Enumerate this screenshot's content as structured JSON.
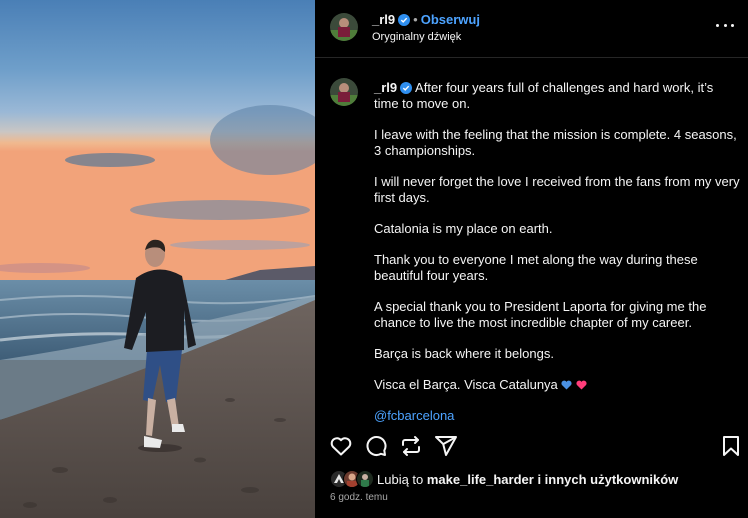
{
  "post": {
    "username": "_rl9",
    "separator": "•",
    "follow_label": "Obserwuj",
    "audio_label": "Oryginalny dźwięk"
  },
  "caption": {
    "username": "_rl9",
    "first_line": "After four years full of challenges and hard work, it’s time to move on.",
    "paragraphs": [
      "I leave with the feeling that the mission is complete. 4 seasons, 3 championships.",
      "I will never forget the love I received from the fans from my very first days.",
      "Catalonia is my place on earth.",
      "Thank you to everyone I met along the way during these beautiful four years.",
      "A special thank you to President Laporta for giving me the chance to live the most incredible chapter of my career.",
      "Barça is back where it belongs.",
      "Visca el Barça. Visca Catalunya"
    ],
    "hashtag_link": "@fcbarcelona"
  },
  "likes": {
    "prefix": "Lubią to ",
    "user": "make_life_harder",
    "suffix": " i innych użytkowników"
  },
  "timestamp": "6 godz. temu",
  "icons": {
    "verified": "verified-badge-icon",
    "more": "more-options-icon",
    "like": "heart-outline-icon",
    "comment": "comment-bubble-icon",
    "repost": "repost-icon",
    "share": "send-icon",
    "save": "bookmark-icon",
    "emoji_blue": "blue-heart-emoji",
    "emoji_pink": "pink-heart-emoji"
  },
  "colors": {
    "background": "#000000",
    "text": "#f5f5f5",
    "link": "#4da3ff",
    "verified": "#2f8ff0",
    "muted": "#a8a8a8",
    "blue_heart": "#4a90e2",
    "pink_heart": "#ff3d7a"
  }
}
